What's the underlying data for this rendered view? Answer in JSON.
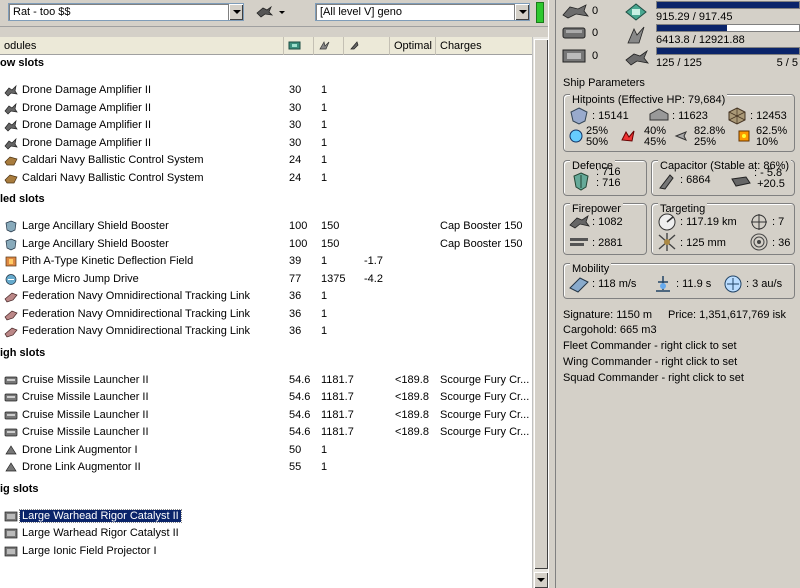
{
  "toolbar": {
    "fit_name": "Rat - too $$",
    "character": "[All level V] geno",
    "status_color": "#2ec82e"
  },
  "columns": {
    "modules": "odules",
    "optimal": "Optimal",
    "charges": "Charges"
  },
  "sections": [
    {
      "title": "ow slots",
      "rows": [
        {
          "icon": "drone-damage-icon",
          "name": "Drone Damage Amplifier II",
          "c1": "30",
          "c2": "1",
          "c3": "",
          "c4": "",
          "c5": ""
        },
        {
          "icon": "drone-damage-icon",
          "name": "Drone Damage Amplifier II",
          "c1": "30",
          "c2": "1",
          "c3": "",
          "c4": "",
          "c5": ""
        },
        {
          "icon": "drone-damage-icon",
          "name": "Drone Damage Amplifier II",
          "c1": "30",
          "c2": "1",
          "c3": "",
          "c4": "",
          "c5": ""
        },
        {
          "icon": "drone-damage-icon",
          "name": "Drone Damage Amplifier II",
          "c1": "30",
          "c2": "1",
          "c3": "",
          "c4": "",
          "c5": ""
        },
        {
          "icon": "ballistic-control-icon",
          "name": "Caldari Navy Ballistic Control System",
          "c1": "24",
          "c2": "1",
          "c3": "",
          "c4": "",
          "c5": ""
        },
        {
          "icon": "ballistic-control-icon",
          "name": "Caldari Navy Ballistic Control System",
          "c1": "24",
          "c2": "1",
          "c3": "",
          "c4": "",
          "c5": ""
        }
      ]
    },
    {
      "title": "led slots",
      "rows": [
        {
          "icon": "shield-booster-icon",
          "name": "Large Ancillary Shield Booster",
          "c1": "100",
          "c2": "150",
          "c3": "",
          "c4": "",
          "c5": "Cap Booster 150"
        },
        {
          "icon": "shield-booster-icon",
          "name": "Large Ancillary Shield Booster",
          "c1": "100",
          "c2": "150",
          "c3": "",
          "c4": "",
          "c5": "Cap Booster 150"
        },
        {
          "icon": "deflection-field-icon",
          "name": "Pith A-Type Kinetic Deflection Field",
          "c1": "39",
          "c2": "1",
          "c3": "-1.7",
          "c4": "",
          "c5": ""
        },
        {
          "icon": "micro-jump-drive-icon",
          "name": "Large Micro Jump Drive",
          "c1": "77",
          "c2": "1375",
          "c3": "-4.2",
          "c4": "",
          "c5": ""
        },
        {
          "icon": "tracking-link-icon",
          "name": "Federation Navy Omnidirectional Tracking Link",
          "c1": "36",
          "c2": "1",
          "c3": "",
          "c4": "",
          "c5": ""
        },
        {
          "icon": "tracking-link-icon",
          "name": "Federation Navy Omnidirectional Tracking Link",
          "c1": "36",
          "c2": "1",
          "c3": "",
          "c4": "",
          "c5": ""
        },
        {
          "icon": "tracking-link-icon",
          "name": "Federation Navy Omnidirectional Tracking Link",
          "c1": "36",
          "c2": "1",
          "c3": "",
          "c4": "",
          "c5": ""
        }
      ]
    },
    {
      "title": "igh slots",
      "rows": [
        {
          "icon": "missile-launcher-icon",
          "name": "Cruise Missile Launcher II",
          "c1": "54.6",
          "c2": "1181.7",
          "c3": "",
          "c4": "<189.8",
          "c5": "Scourge Fury Cr..."
        },
        {
          "icon": "missile-launcher-icon",
          "name": "Cruise Missile Launcher II",
          "c1": "54.6",
          "c2": "1181.7",
          "c3": "",
          "c4": "<189.8",
          "c5": "Scourge Fury Cr..."
        },
        {
          "icon": "missile-launcher-icon",
          "name": "Cruise Missile Launcher II",
          "c1": "54.6",
          "c2": "1181.7",
          "c3": "",
          "c4": "<189.8",
          "c5": "Scourge Fury Cr..."
        },
        {
          "icon": "missile-launcher-icon",
          "name": "Cruise Missile Launcher II",
          "c1": "54.6",
          "c2": "1181.7",
          "c3": "",
          "c4": "<189.8",
          "c5": "Scourge Fury Cr..."
        },
        {
          "icon": "drone-link-icon",
          "name": "Drone Link Augmentor I",
          "c1": "50",
          "c2": "1",
          "c3": "",
          "c4": "",
          "c5": ""
        },
        {
          "icon": "drone-link-icon",
          "name": "Drone Link Augmentor II",
          "c1": "55",
          "c2": "1",
          "c3": "",
          "c4": "",
          "c5": ""
        }
      ]
    },
    {
      "title": "ig slots",
      "rows": [
        {
          "icon": "rig-icon",
          "name": "Large Warhead Rigor Catalyst II",
          "c1": "",
          "c2": "",
          "c3": "",
          "c4": "",
          "c5": "",
          "selected": true
        },
        {
          "icon": "rig-icon",
          "name": "Large Warhead Rigor Catalyst II",
          "c1": "",
          "c2": "",
          "c3": "",
          "c4": "",
          "c5": ""
        },
        {
          "icon": "rig-icon",
          "name": "Large Ionic Field Projector I",
          "c1": "",
          "c2": "",
          "c3": "",
          "c4": "",
          "c5": ""
        }
      ]
    }
  ],
  "slots": {
    "turret": "0",
    "launcher": "0",
    "rig": "0"
  },
  "resources": {
    "cpu": {
      "text": "915.29 / 917.45",
      "fraction": 0.9977
    },
    "powergrid": {
      "text": "6413.8 / 12921.88",
      "fraction": 0.4963
    },
    "drones": {
      "text": "125 / 125",
      "extra": "5 / 5",
      "fraction": 1.0
    }
  },
  "ship": {
    "title": "Ship Parameters",
    "hitpoints": {
      "title": "Hitpoints (Effective HP: 79,684)",
      "shield": "15141",
      "armor": "11623",
      "hull": "12453",
      "resists": [
        {
          "a": "25%",
          "b": "50%"
        },
        {
          "a": "40%",
          "b": "45%"
        },
        {
          "a": "82.8%",
          "b": "25%"
        },
        {
          "a": "62.5%",
          "b": "10%"
        }
      ]
    },
    "defence": {
      "title": "Defence",
      "a": "716",
      "b": "716"
    },
    "capacitor": {
      "title": "Capacitor (Stable at: 86%)",
      "amount": "6864",
      "delta1": "- 5.8",
      "delta2": "+20.5"
    },
    "firepower": {
      "title": "Firepower",
      "volley": "1082",
      "dps": "2881"
    },
    "targeting": {
      "title": "Targeting",
      "range": "117.19 km",
      "targets": "7",
      "resolution": "125 mm",
      "sensor": "36"
    },
    "mobility": {
      "title": "Mobility",
      "speed": "118 m/s",
      "align": "11.9 s",
      "warp": "3 au/s"
    },
    "signature": "Signature: 1150 m",
    "price": "Price: 1,351,617,769 isk",
    "cargohold": "Cargohold: 665 m3",
    "fleet": "Fleet Commander - right click to set",
    "wing": "Wing Commander - right click to set",
    "squad": "Squad Commander - right click to set"
  }
}
